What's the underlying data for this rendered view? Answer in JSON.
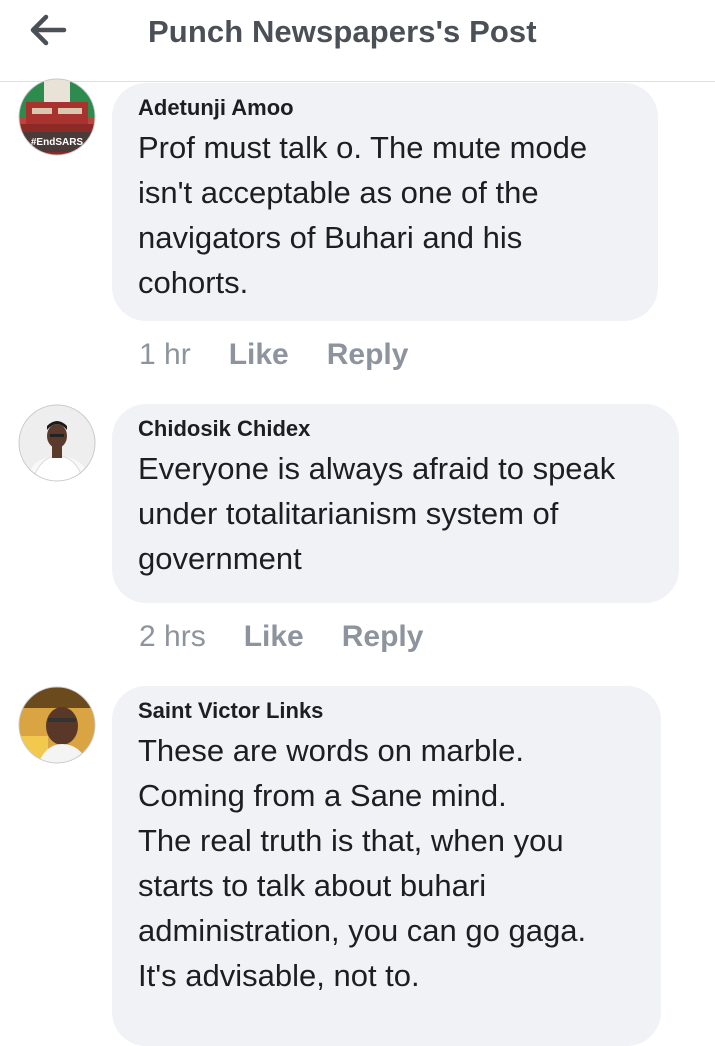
{
  "header": {
    "back_icon": "arrow-left-icon",
    "title": "Punch Newspapers's Post"
  },
  "comments": [
    {
      "author": "Adetunji Amoo",
      "text": "Prof must talk o. The mute mode\nisn't acceptable as one of the\nnavigators of Buhari and his\ncohorts.",
      "time": "1 hr",
      "like_label": "Like",
      "reply_label": "Reply",
      "avatar_badge": "#EndSARS"
    },
    {
      "author": "Chidosik Chidex",
      "text": "Everyone is always afraid to speak\nunder  totalitarianism system of\ngovernment",
      "time": "2 hrs",
      "like_label": "Like",
      "reply_label": "Reply"
    },
    {
      "author": "Saint Victor Links",
      "text": "These are words on marble.\nComing from a Sane mind.\nThe real truth is that, when you\nstarts to talk about buhari\nadministration, you can go gaga.\nIt's advisable, not to."
    }
  ],
  "colors": {
    "bubble_bg": "#f0f2f5",
    "meta_text": "#8d949e",
    "header_title": "#4b4f56"
  }
}
